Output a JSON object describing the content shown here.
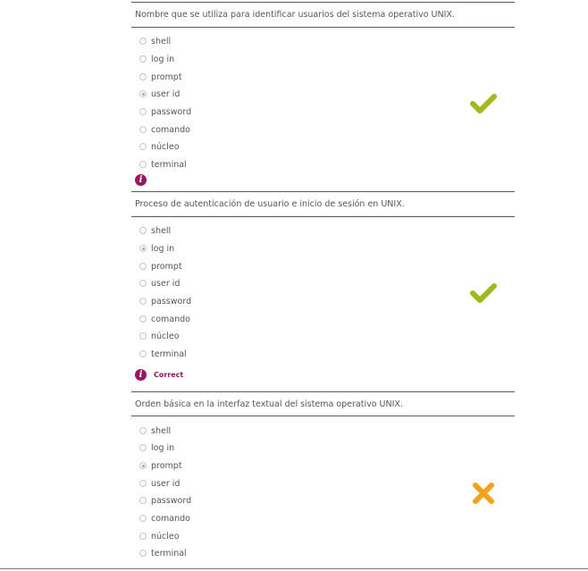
{
  "colors": {
    "correct": "#a2b81c",
    "incorrect": "#f0a41c",
    "info": "#9b1660",
    "feedback_text": "#8a1a57"
  },
  "questions": [
    {
      "text": "Nombre que se utiliza para identificar usuarios del sistema operativo UNIX.",
      "options": [
        "shell",
        "log in",
        "prompt",
        "user id",
        "password",
        "comando",
        "núcleo",
        "terminal"
      ],
      "selected": "user id",
      "result_icon": "check-icon",
      "info_icon": "info-icon",
      "feedback": ""
    },
    {
      "text": "Proceso de autenticación de usuario e inicio de sesión en UNIX.",
      "options": [
        "shell",
        "log in",
        "prompt",
        "user id",
        "password",
        "comando",
        "núcleo",
        "terminal"
      ],
      "selected": "log in",
      "result_icon": "check-icon",
      "info_icon": "info-icon",
      "feedback": "Correct"
    },
    {
      "text": "Orden básica en la interfaz textual del sistema operativo UNIX.",
      "options": [
        "shell",
        "log in",
        "prompt",
        "user id",
        "password",
        "comando",
        "núcleo",
        "terminal"
      ],
      "selected": "prompt",
      "result_icon": "cross-icon",
      "info_icon": "info-icon",
      "feedback": ""
    }
  ]
}
